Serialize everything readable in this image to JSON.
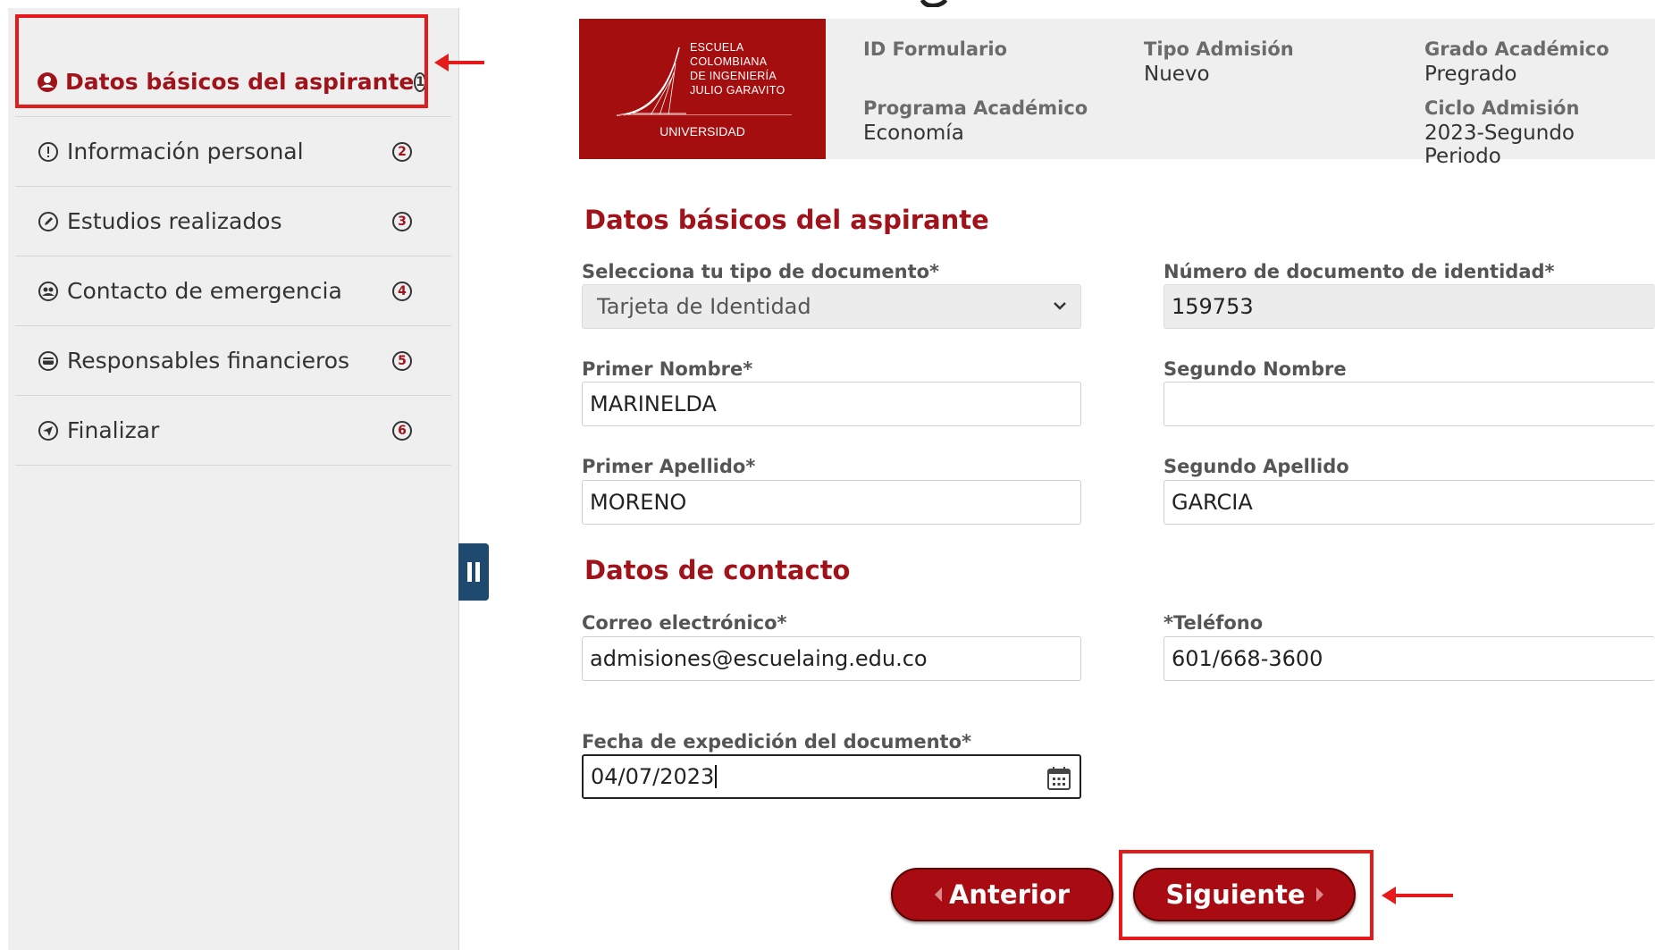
{
  "sidebar": {
    "items": [
      {
        "label": "Datos básicos del aspirante",
        "num": "1"
      },
      {
        "label": "Información personal",
        "num": "2"
      },
      {
        "label": "Estudios realizados",
        "num": "3"
      },
      {
        "label": "Contacto de emergencia",
        "num": "4"
      },
      {
        "label": "Responsables financieros",
        "num": "5"
      },
      {
        "label": "Finalizar",
        "num": "6"
      }
    ]
  },
  "logo": {
    "lines": [
      "ESCUELA",
      "COLOMBIANA",
      "DE INGENIERÍA",
      "JULIO GARAVITO"
    ],
    "sub": "UNIVERSIDAD"
  },
  "header": {
    "id_formulario": {
      "label": "ID Formulario",
      "value": ""
    },
    "tipo_admision": {
      "label": "Tipo Admisión",
      "value": "Nuevo"
    },
    "grado_academico": {
      "label": "Grado Académico",
      "value": "Pregrado"
    },
    "programa_academico": {
      "label": "Programa Académico",
      "value": "Economía"
    },
    "ciclo_admision": {
      "label": "Ciclo Admisión",
      "value": "2023-Segundo Periodo"
    }
  },
  "form": {
    "section_basic": "Datos básicos del aspirante",
    "tipo_documento": {
      "label": "Selecciona tu tipo de documento*",
      "value": "Tarjeta de Identidad"
    },
    "numero_documento": {
      "label": "Número de documento de identidad*",
      "value": "159753"
    },
    "primer_nombre": {
      "label": "Primer Nombre*",
      "value": "MARINELDA"
    },
    "segundo_nombre": {
      "label": "Segundo Nombre",
      "value": ""
    },
    "primer_apellido": {
      "label": "Primer Apellido*",
      "value": "MORENO"
    },
    "segundo_apellido": {
      "label": "Segundo Apellido",
      "value": "GARCIA"
    },
    "section_contact": "Datos de contacto",
    "correo": {
      "label": "Correo electrónico*",
      "value": "admisiones@escuelaing.edu.co"
    },
    "telefono": {
      "label": "*Teléfono",
      "value": "601/668-3600"
    },
    "fecha_expedicion": {
      "label": "Fecha de expedición del documento*",
      "value": "04/07/2023"
    }
  },
  "buttons": {
    "prev": "Anterior",
    "next": "Siguiente"
  },
  "colors": {
    "brand": "#a80c12",
    "annotation": "#e31b1b",
    "sidebar_bg": "#efefef"
  }
}
